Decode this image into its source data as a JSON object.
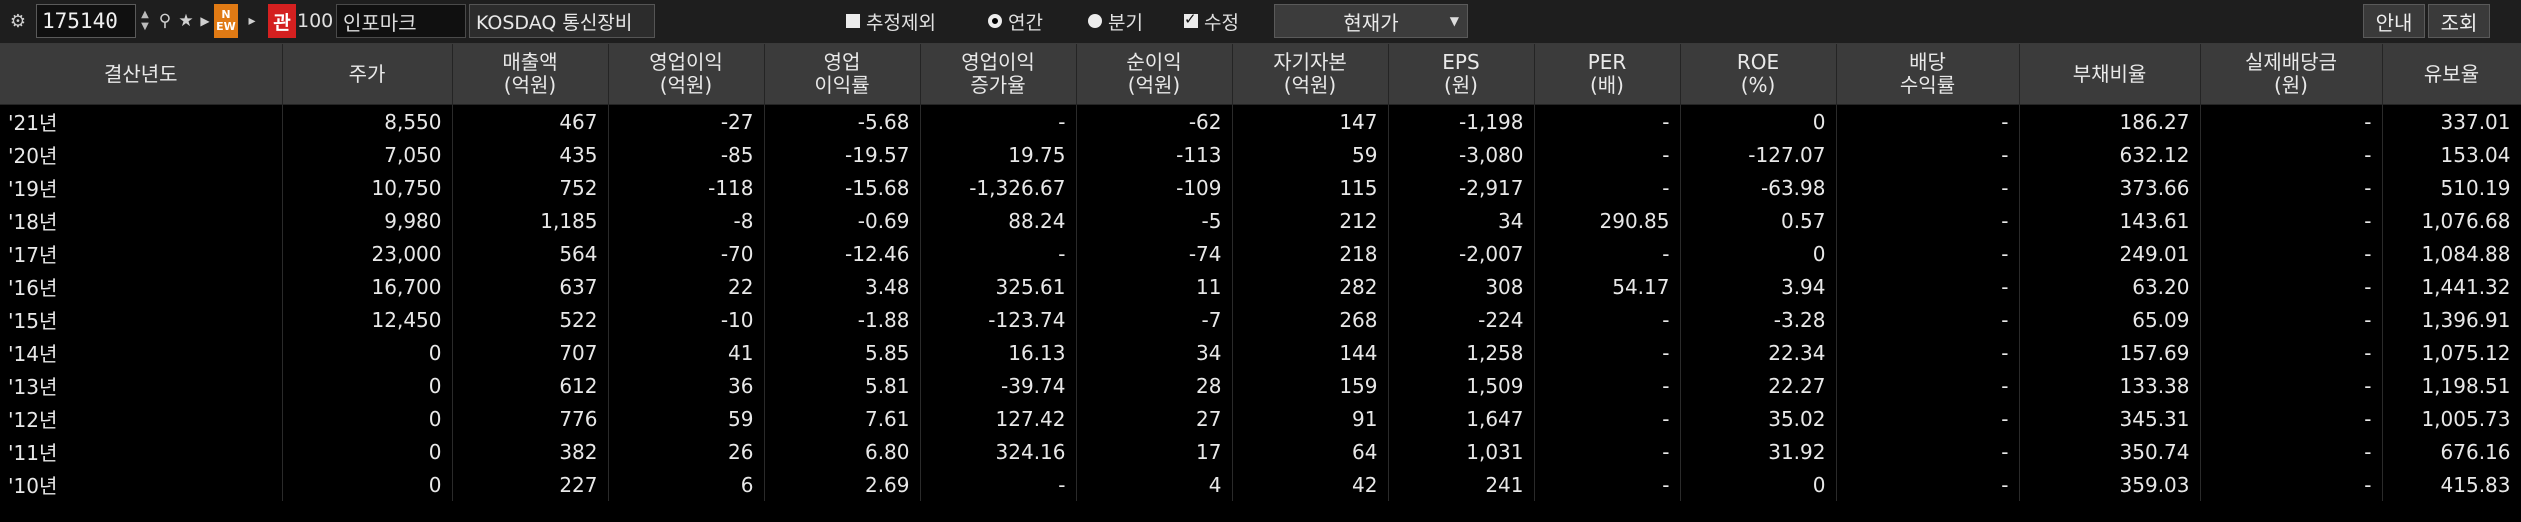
{
  "toolbar": {
    "code": "175140",
    "new_badge": "N\nEW",
    "gwan_label": "관",
    "gwan_num": "100",
    "stock_name": "인포마크",
    "market_label": "KOSDAQ 통신장비",
    "opt_exclude_estimate": "추정제외",
    "opt_annual": "연간",
    "opt_quarter": "분기",
    "opt_revised": "수정",
    "price_select": "현재가",
    "guide_btn": "안내",
    "query_btn": "조회"
  },
  "colors": {
    "positive": "#ff4b4b",
    "negative": "#2ea6ff",
    "header_bg": "#3b3b3b"
  },
  "table": {
    "headers": [
      "결산년도",
      "주가",
      "매출액\n(억원)",
      "영업이익\n(억원)",
      "영업\n이익률",
      "영업이익\n증가율",
      "순이익\n(억원)",
      "자기자본\n(억원)",
      "EPS\n(원)",
      "PER\n(배)",
      "ROE\n(%)",
      "배당\n수익률",
      "부채비율",
      "실제배당금\n(원)",
      "유보율"
    ],
    "rows": [
      [
        "'21년",
        "8,550",
        "467",
        "-27",
        "-5.68",
        "-",
        "-62",
        "147",
        "-1,198",
        "-",
        "0",
        "-",
        "186.27",
        "-",
        "337.01"
      ],
      [
        "'20년",
        "7,050",
        "435",
        "-85",
        "-19.57",
        "19.75",
        "-113",
        "59",
        "-3,080",
        "-",
        "-127.07",
        "-",
        "632.12",
        "-",
        "153.04"
      ],
      [
        "'19년",
        "10,750",
        "752",
        "-118",
        "-15.68",
        "-1,326.67",
        "-109",
        "115",
        "-2,917",
        "-",
        "-63.98",
        "-",
        "373.66",
        "-",
        "510.19"
      ],
      [
        "'18년",
        "9,980",
        "1,185",
        "-8",
        "-0.69",
        "88.24",
        "-5",
        "212",
        "34",
        "290.85",
        "0.57",
        "-",
        "143.61",
        "-",
        "1,076.68"
      ],
      [
        "'17년",
        "23,000",
        "564",
        "-70",
        "-12.46",
        "-",
        "-74",
        "218",
        "-2,007",
        "-",
        "0",
        "-",
        "249.01",
        "-",
        "1,084.88"
      ],
      [
        "'16년",
        "16,700",
        "637",
        "22",
        "3.48",
        "325.61",
        "11",
        "282",
        "308",
        "54.17",
        "3.94",
        "-",
        "63.20",
        "-",
        "1,441.32"
      ],
      [
        "'15년",
        "12,450",
        "522",
        "-10",
        "-1.88",
        "-123.74",
        "-7",
        "268",
        "-224",
        "-",
        "-3.28",
        "-",
        "65.09",
        "-",
        "1,396.91"
      ],
      [
        "'14년",
        "0",
        "707",
        "41",
        "5.85",
        "16.13",
        "34",
        "144",
        "1,258",
        "-",
        "22.34",
        "-",
        "157.69",
        "-",
        "1,075.12"
      ],
      [
        "'13년",
        "0",
        "612",
        "36",
        "5.81",
        "-39.74",
        "28",
        "159",
        "1,509",
        "-",
        "22.27",
        "-",
        "133.38",
        "-",
        "1,198.51"
      ],
      [
        "'12년",
        "0",
        "776",
        "59",
        "7.61",
        "127.42",
        "27",
        "91",
        "1,647",
        "-",
        "35.02",
        "-",
        "345.31",
        "-",
        "1,005.73"
      ],
      [
        "'11년",
        "0",
        "382",
        "26",
        "6.80",
        "324.16",
        "17",
        "64",
        "1,031",
        "-",
        "31.92",
        "-",
        "350.74",
        "-",
        "676.16"
      ],
      [
        "'10년",
        "0",
        "227",
        "6",
        "2.69",
        "-",
        "4",
        "42",
        "241",
        "-",
        "0",
        "-",
        "359.03",
        "-",
        "415.83"
      ]
    ],
    "price_colors": [
      "pos",
      "neg",
      "neg",
      "pos",
      "neg",
      "pos",
      "pos",
      "",
      "",
      "",
      "",
      ""
    ]
  }
}
